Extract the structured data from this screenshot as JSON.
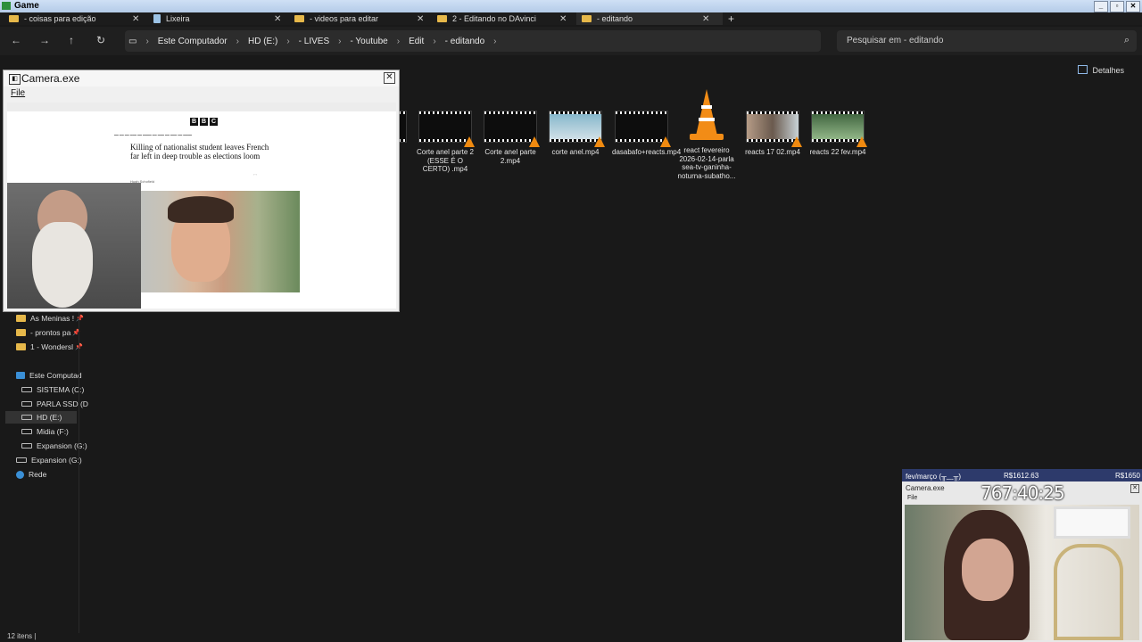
{
  "outer_window": {
    "title": "Game"
  },
  "tabs": [
    {
      "label": "- coisas para edição",
      "icon": "folder-icon"
    },
    {
      "label": "Lixeira",
      "icon": "recycle-bin-icon"
    },
    {
      "label": "- videos para editar",
      "icon": "folder-icon"
    },
    {
      "label": "2 - Editando no DAvinci",
      "icon": "folder-icon"
    },
    {
      "label": "- editando",
      "icon": "folder-icon",
      "active": true
    }
  ],
  "breadcrumbs": [
    "Este Computador",
    "HD (E:)",
    "- LIVES",
    "- Youtube",
    "Edit",
    "- editando"
  ],
  "search": {
    "placeholder": "Pesquisar em - editando"
  },
  "toolbar": {
    "details_label": "Detalhes"
  },
  "sidebar": {
    "quick_access": [
      {
        "label": "As Meninas !"
      },
      {
        "label": "- prontos pa"
      },
      {
        "label": "1 - Wondersl"
      }
    ],
    "tree": [
      {
        "label": "Este Computad",
        "icon": "computer-icon"
      },
      {
        "label": "SISTEMA (C:)",
        "icon": "drive-icon"
      },
      {
        "label": "PARLA SSD (D",
        "icon": "drive-icon"
      },
      {
        "label": "HD (E:)",
        "icon": "drive-icon",
        "selected": true
      },
      {
        "label": "Midia (F:)",
        "icon": "drive-icon"
      },
      {
        "label": "Expansion (G:)",
        "icon": "drive-icon"
      },
      {
        "label": "Expansion (G:)",
        "icon": "drive-icon"
      },
      {
        "label": "Rede",
        "icon": "network-icon"
      }
    ]
  },
  "files": [
    {
      "name": "Corte anel parte 2 (ESSE É O CERTO) .mp4"
    },
    {
      "name": "Corte anel parte 2.mp4"
    },
    {
      "name": "corte anel.mp4"
    },
    {
      "name": "dasabafo+reacts.mp4"
    },
    {
      "name": "react fevereiro 2026-02-14-parla sea-tv-ganinha-noturna-subatho..."
    },
    {
      "name": "reacts 17 02.mp4"
    },
    {
      "name": "reacts 22 fev.mp4"
    }
  ],
  "status_bar": {
    "count": "12 itens"
  },
  "camera_window": {
    "title": "Camera.exe",
    "menu": "File",
    "article": {
      "headline": "Killing of nationalist student leaves French far left in deep trouble as elections loom",
      "author": "Hugh Schofield"
    }
  },
  "overlay": {
    "label": "fev/março (╥﹏╥)",
    "amount1": "R$1612.63",
    "amount2": "R$1650",
    "window_title": "Camera.exe",
    "menu": "File",
    "timer": "767:40:25"
  },
  "colors": {
    "background": "#191919",
    "folder": "#e6b84a",
    "accent": "#3a8fd6",
    "vlc_orange": "#f28c16"
  }
}
